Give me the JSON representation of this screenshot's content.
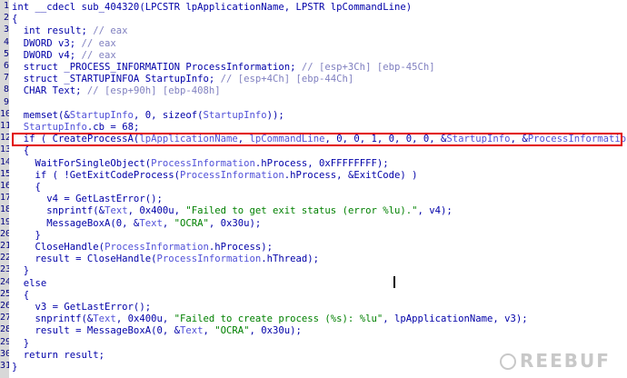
{
  "editor": {
    "gutter_numbers": [
      "1",
      "2",
      "3",
      "4",
      "5",
      "6",
      "7",
      "8",
      "9",
      "10",
      "11",
      "12",
      "13",
      "14",
      "15",
      "16",
      "17",
      "18",
      "19",
      "20",
      "21",
      "22",
      "23",
      "24",
      "25",
      "26",
      "27",
      "28",
      "29",
      "30",
      "31"
    ],
    "lines": [
      [
        {
          "t": "int __cdecl sub_404320(LPCSTR lpApplicationName, LPSTR lpCommandLine)",
          "c": "p"
        }
      ],
      [
        {
          "t": "{",
          "c": "p"
        }
      ],
      [
        {
          "t": "  int result; ",
          "c": "p"
        },
        {
          "t": "// eax",
          "c": "c"
        }
      ],
      [
        {
          "t": "  DWORD v3; ",
          "c": "p"
        },
        {
          "t": "// eax",
          "c": "c"
        }
      ],
      [
        {
          "t": "  DWORD v4; ",
          "c": "p"
        },
        {
          "t": "// eax",
          "c": "c"
        }
      ],
      [
        {
          "t": "  struct _PROCESS_INFORMATION ProcessInformation; ",
          "c": "p"
        },
        {
          "t": "// [esp+3Ch] [ebp-45Ch]",
          "c": "c"
        }
      ],
      [
        {
          "t": "  struct _STARTUPINFOA StartupInfo; ",
          "c": "p"
        },
        {
          "t": "// [esp+4Ch] [ebp-44Ch]",
          "c": "c"
        }
      ],
      [
        {
          "t": "  CHAR Text; ",
          "c": "p"
        },
        {
          "t": "// [esp+90h] [ebp-408h]",
          "c": "c"
        }
      ],
      [
        {
          "t": "",
          "c": "p"
        }
      ],
      [
        {
          "t": "  memset(&",
          "c": "p"
        },
        {
          "t": "StartupInfo",
          "c": "n"
        },
        {
          "t": ", 0, sizeof(",
          "c": "p"
        },
        {
          "t": "StartupInfo",
          "c": "n"
        },
        {
          "t": "));",
          "c": "p"
        }
      ],
      [
        {
          "t": "  StartupInfo",
          "c": "n"
        },
        {
          "t": ".cb = 68;",
          "c": "p"
        }
      ],
      [
        {
          "t": "  if ( CreateProcessA(",
          "c": "p"
        },
        {
          "t": "lpApplicationName",
          "c": "n"
        },
        {
          "t": ", ",
          "c": "p"
        },
        {
          "t": "lpCommandLine",
          "c": "n"
        },
        {
          "t": ", 0, 0, 1, 0, 0, 0, &",
          "c": "p"
        },
        {
          "t": "StartupInfo",
          "c": "n"
        },
        {
          "t": ", &",
          "c": "p"
        },
        {
          "t": "ProcessInformation",
          "c": "n"
        },
        {
          "t": ") )",
          "c": "p"
        }
      ],
      [
        {
          "t": "  {",
          "c": "p"
        }
      ],
      [
        {
          "t": "    WaitForSingleObject(",
          "c": "p"
        },
        {
          "t": "ProcessInformation",
          "c": "n"
        },
        {
          "t": ".hProcess, 0xFFFFFFFF);",
          "c": "p"
        }
      ],
      [
        {
          "t": "    if ( !GetExitCodeProcess(",
          "c": "p"
        },
        {
          "t": "ProcessInformation",
          "c": "n"
        },
        {
          "t": ".hProcess, &ExitCode) )",
          "c": "p"
        }
      ],
      [
        {
          "t": "    {",
          "c": "p"
        }
      ],
      [
        {
          "t": "      v4 = GetLastError();",
          "c": "p"
        }
      ],
      [
        {
          "t": "      snprintf(&",
          "c": "p"
        },
        {
          "t": "Text",
          "c": "n"
        },
        {
          "t": ", 0x400u, ",
          "c": "p"
        },
        {
          "t": "\"Failed to get exit status (error %lu).\"",
          "c": "s"
        },
        {
          "t": ", v4);",
          "c": "p"
        }
      ],
      [
        {
          "t": "      MessageBoxA(0, &",
          "c": "p"
        },
        {
          "t": "Text",
          "c": "n"
        },
        {
          "t": ", ",
          "c": "p"
        },
        {
          "t": "\"OCRA\"",
          "c": "s"
        },
        {
          "t": ", 0x30u);",
          "c": "p"
        }
      ],
      [
        {
          "t": "    }",
          "c": "p"
        }
      ],
      [
        {
          "t": "    CloseHandle(",
          "c": "p"
        },
        {
          "t": "ProcessInformation",
          "c": "n"
        },
        {
          "t": ".hProcess);",
          "c": "p"
        }
      ],
      [
        {
          "t": "    result = CloseHandle(",
          "c": "p"
        },
        {
          "t": "ProcessInformation",
          "c": "n"
        },
        {
          "t": ".hThread);",
          "c": "p"
        }
      ],
      [
        {
          "t": "  }",
          "c": "p"
        }
      ],
      [
        {
          "t": "  else",
          "c": "p"
        }
      ],
      [
        {
          "t": "  {",
          "c": "p"
        }
      ],
      [
        {
          "t": "    v3 = GetLastError();",
          "c": "p"
        }
      ],
      [
        {
          "t": "    snprintf(&",
          "c": "p"
        },
        {
          "t": "Text",
          "c": "n"
        },
        {
          "t": ", 0x400u, ",
          "c": "p"
        },
        {
          "t": "\"Failed to create process (%s): %lu\"",
          "c": "s"
        },
        {
          "t": ", lpApplicationName, v3);",
          "c": "p"
        }
      ],
      [
        {
          "t": "    result = MessageBoxA(0, &",
          "c": "p"
        },
        {
          "t": "Text",
          "c": "n"
        },
        {
          "t": ", ",
          "c": "p"
        },
        {
          "t": "\"OCRA\"",
          "c": "s"
        },
        {
          "t": ", 0x30u);",
          "c": "p"
        }
      ],
      [
        {
          "t": "  }",
          "c": "p"
        }
      ],
      [
        {
          "t": "  return result;",
          "c": "p"
        }
      ],
      [
        {
          "t": "}",
          "c": "p"
        }
      ]
    ]
  },
  "watermark": {
    "text": "REEBUF"
  }
}
